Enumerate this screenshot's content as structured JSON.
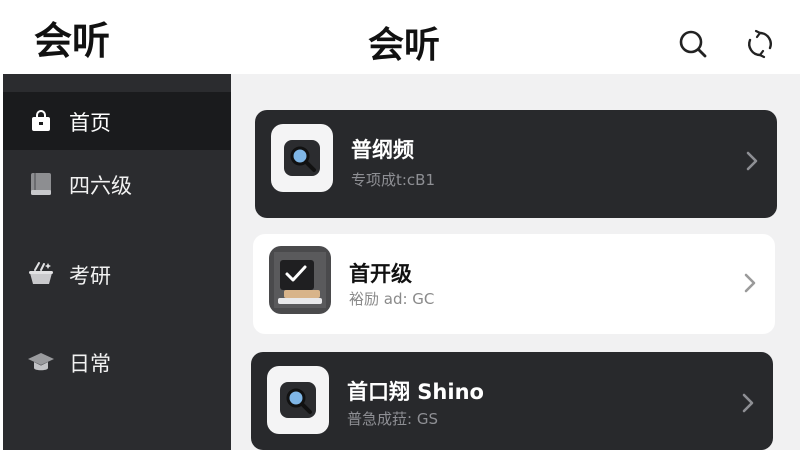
{
  "app": {
    "logo_text": "会听",
    "page_title": "会听"
  },
  "header": {
    "search_icon": "search-icon",
    "refresh_icon": "refresh-icon"
  },
  "sidebar": {
    "items": [
      {
        "label": "首页",
        "icon": "bag-icon",
        "active": true
      },
      {
        "label": "四六级",
        "icon": "book-icon",
        "active": false
      },
      {
        "label": "考研",
        "icon": "bowl-sparkle-icon",
        "active": false
      },
      {
        "label": "日常",
        "icon": "graduation-cap-icon",
        "active": false
      }
    ]
  },
  "cards": [
    {
      "title": "普纲频",
      "subtitle": "专项成t:cB1",
      "style": "dark",
      "icon": "magnifier-icon"
    },
    {
      "title": "首开级",
      "subtitle": "裕励 ad: GC",
      "style": "light",
      "icon": "checklist-board-icon"
    },
    {
      "title": "首口翔 Shino",
      "subtitle": "普急成菈: GS",
      "style": "dark",
      "icon": "magnifier-icon"
    }
  ],
  "colors": {
    "sidebar_bg": "#2b2c2f",
    "sidebar_active": "#1a1b1d",
    "content_bg": "#f1f1f2",
    "card_dark": "#28292c",
    "card_light": "#ffffff",
    "magnifier_lens": "#7fb6e6"
  }
}
